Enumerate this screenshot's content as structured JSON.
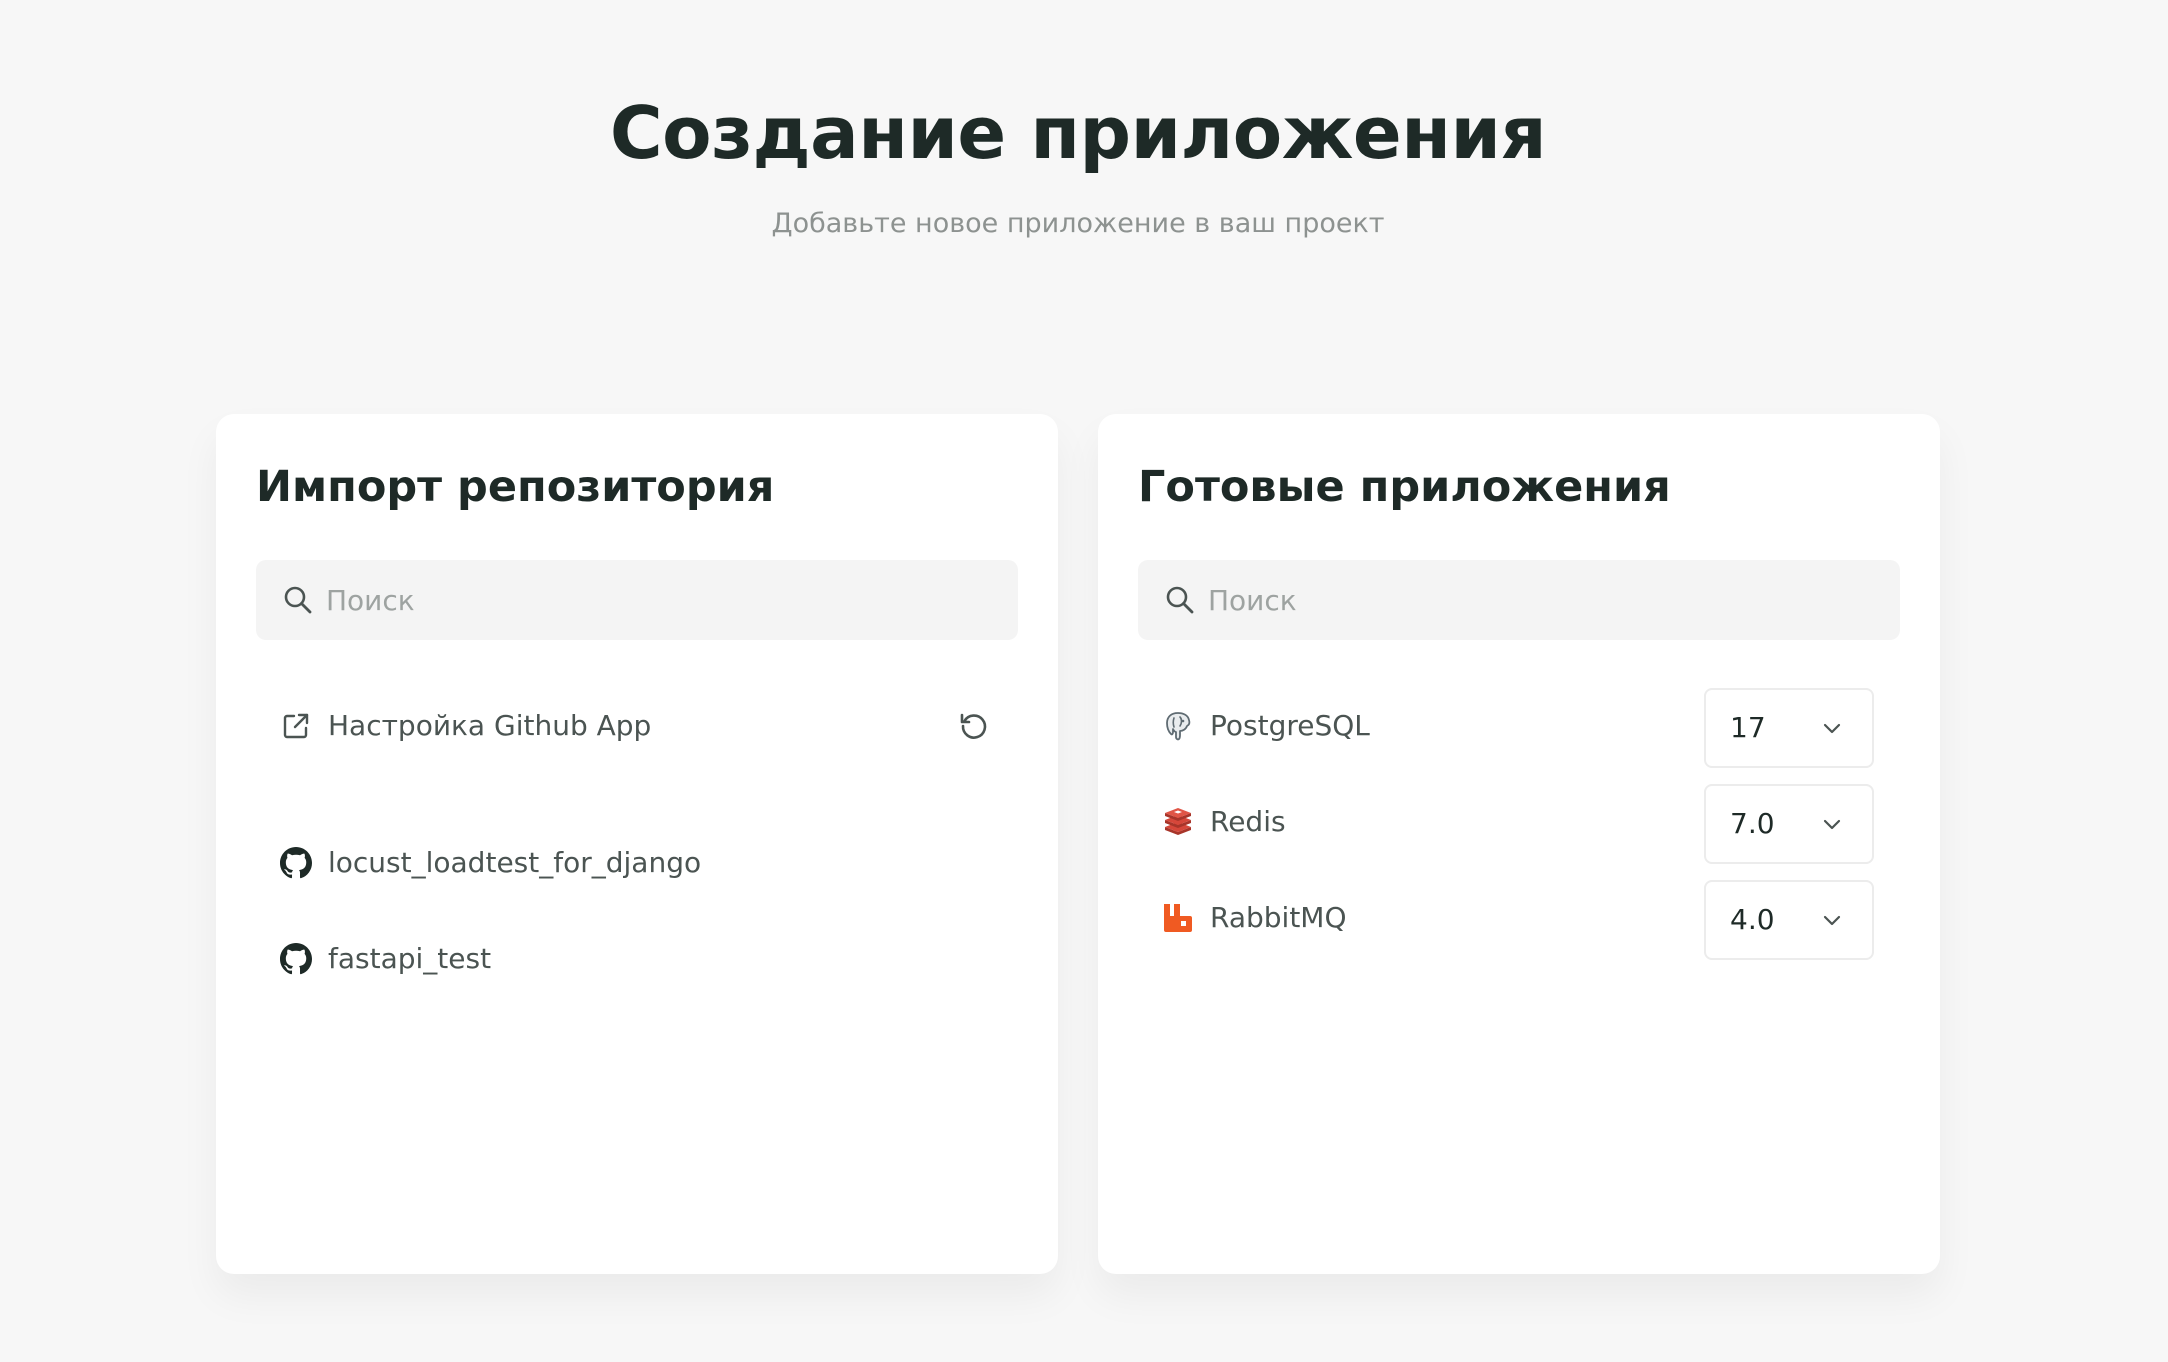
{
  "header": {
    "title": "Создание приложения",
    "subtitle": "Добавьте новое приложение в ваш проект"
  },
  "import_card": {
    "title": "Импорт репозитория",
    "search_placeholder": "Поиск",
    "settings_link": {
      "label": "Настройка Github App",
      "icon": "external-link-icon"
    },
    "refresh_icon": "refresh-icon",
    "repositories": [
      {
        "name": "locust_loadtest_for_django",
        "icon": "github-icon"
      },
      {
        "name": "fastapi_test",
        "icon": "github-icon"
      }
    ]
  },
  "apps_card": {
    "title": "Готовые приложения",
    "search_placeholder": "Поиск",
    "apps": [
      {
        "name": "PostgreSQL",
        "icon": "postgresql-icon",
        "version": "17"
      },
      {
        "name": "Redis",
        "icon": "redis-icon",
        "version": "7.0"
      },
      {
        "name": "RabbitMQ",
        "icon": "rabbitmq-icon",
        "version": "4.0"
      }
    ]
  },
  "colors": {
    "background": "#f7f7f7",
    "card": "#ffffff",
    "title": "#1e2a27",
    "muted": "#8d9290",
    "rabbitmq": "#f05a22",
    "redis": "#c7412f"
  }
}
